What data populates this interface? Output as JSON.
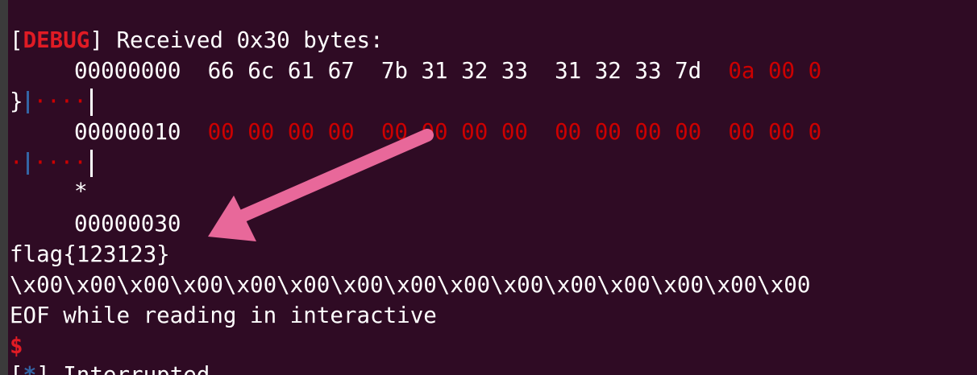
{
  "colors": {
    "background": "#2f0b24",
    "text": "#ffffff",
    "debug_red": "#e01b24",
    "hex_red": "#cc0000",
    "separator_blue": "#3465a4",
    "annotation_arrow": "#e8689a"
  },
  "terminal": {
    "debug_open": "[",
    "debug_tag": "DEBUG",
    "debug_close": "]",
    "received_text": " Received 0x30 bytes:",
    "row1_offset": "00000000",
    "row1_group1": "66 6c 61 67",
    "row1_group2": "7b 31 32 33",
    "row1_group3": "31 32 33 7d",
    "row1_group4": "0a 00 0",
    "row1_ascii_brace": "}",
    "row1_ascii_dots": "····",
    "row2_offset": "00000010",
    "row2_group1": "00 00 00 00",
    "row2_group2": "00 00 00 00",
    "row2_group3": "00 00 00 00",
    "row2_group4": "00 00 0",
    "row2_ascii_dot": "·",
    "row2_ascii_dots": "····",
    "repeat_star": "*",
    "row3_offset": "00000030",
    "flag_line": "flag{123123}",
    "null_bytes_line": "\\x00\\x00\\x00\\x00\\x00\\x00\\x00\\x00\\x00\\x00\\x00\\x00\\x00\\x00\\x00",
    "eof_line": "EOF while reading in interactive",
    "prompt": "$",
    "interrupted_open": "[",
    "interrupted_star": "*",
    "interrupted_text": "] Interrupted"
  },
  "annotation": {
    "icon": "arrow-icon"
  }
}
